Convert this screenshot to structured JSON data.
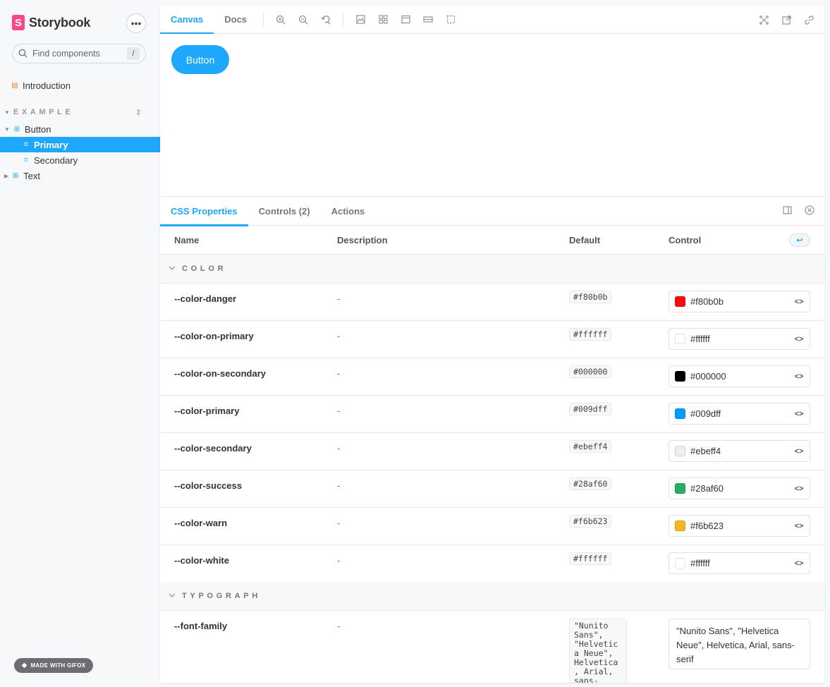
{
  "sidebar": {
    "brand": "Storybook",
    "menu_label": "•••",
    "search_placeholder": "Find components",
    "search_shortcut": "/",
    "intro": "Introduction",
    "group_label": "EXAMPLE",
    "items": {
      "button": "Button",
      "primary": "Primary",
      "secondary": "Secondary",
      "text": "Text"
    },
    "gifox_badge": "MADE WITH GIFOX"
  },
  "toolbar": {
    "tabs": [
      "Canvas",
      "Docs"
    ],
    "active_tab": "Canvas",
    "accent": "#1ea7fd"
  },
  "canvas": {
    "story_button": "Button"
  },
  "addons": {
    "tabs": [
      "CSS Properties",
      "Controls (2)",
      "Actions"
    ],
    "active_tab": "CSS Properties",
    "columns": [
      "Name",
      "Description",
      "Default",
      "Control"
    ],
    "sections": {
      "color": "COLOR",
      "typography": "TYPOGRAPH"
    },
    "rows": [
      {
        "name": "--color-danger",
        "desc": "-",
        "default": "#f80b0b",
        "value": "#f80b0b",
        "color": "#f80b0b"
      },
      {
        "name": "--color-on-primary",
        "desc": "-",
        "default": "#ffffff",
        "value": "#ffffff",
        "color": "#ffffff"
      },
      {
        "name": "--color-on-secondary",
        "desc": "-",
        "default": "#000000",
        "value": "#000000",
        "color": "#000000"
      },
      {
        "name": "--color-primary",
        "desc": "-",
        "default": "#009dff",
        "value": "#009dff",
        "color": "#009dff"
      },
      {
        "name": "--color-secondary",
        "desc": "-",
        "default": "#ebeff4",
        "value": "#ebeff4",
        "color": "#ebeff4"
      },
      {
        "name": "--color-success",
        "desc": "-",
        "default": "#28af60",
        "value": "#28af60",
        "color": "#28af60"
      },
      {
        "name": "--color-warn",
        "desc": "-",
        "default": "#f6b623",
        "value": "#f6b623",
        "color": "#f6b623"
      },
      {
        "name": "--color-white",
        "desc": "-",
        "default": "#ffffff",
        "value": "#ffffff",
        "color": "#ffffff"
      }
    ],
    "font_row": {
      "name": "--font-family",
      "desc": "-",
      "default": "\"Nunito Sans\", \"Helvetica Neue\", Helvetica, Arial, sans-serif",
      "value": "\"Nunito Sans\", \"Helvetica Neue\", Helvetica, Arial, sans-serif"
    }
  }
}
